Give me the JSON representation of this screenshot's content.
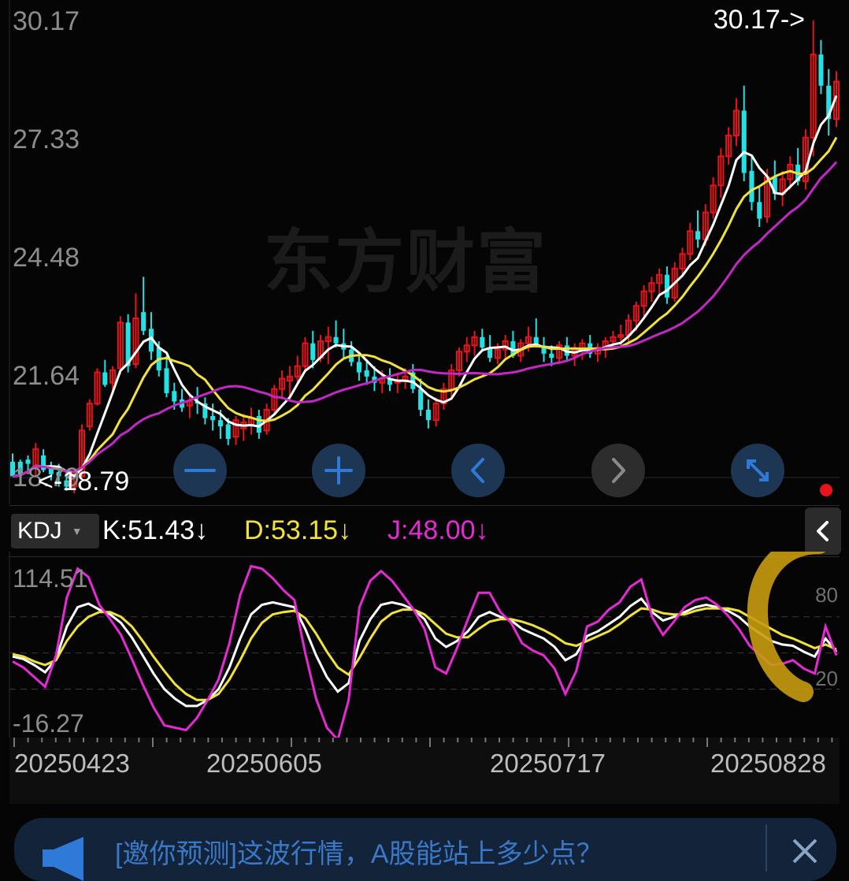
{
  "price_axis": {
    "labels": [
      "30.17",
      "27.33",
      "24.48",
      "21.64",
      "18.79"
    ],
    "ymin": 18.79,
    "ymax": 30.17
  },
  "high_marker": "30.17->",
  "low_marker": "<-18.79",
  "watermark": "东方财富",
  "controls": [
    {
      "name": "zoom-out-button",
      "icon": "minus-icon"
    },
    {
      "name": "zoom-in-button",
      "icon": "plus-icon"
    },
    {
      "name": "scroll-left-button",
      "icon": "chevron-left-icon"
    },
    {
      "name": "scroll-right-button",
      "icon": "chevron-right-icon"
    },
    {
      "name": "expand-button",
      "icon": "expand-icon"
    }
  ],
  "indicator": {
    "name": "KDJ",
    "k_text": "K:51.43↓",
    "d_text": "D:53.15↓",
    "j_text": "J:48.00↓",
    "k_color": "#ffffff",
    "d_color": "#f0e23a",
    "j_color": "#e629d4"
  },
  "kdj_axis": {
    "top": "114.51",
    "bottom": "-16.27",
    "ref_high": "80",
    "ref_low": "20",
    "ymin": -16.27,
    "ymax": 114.51
  },
  "dates": [
    "20250423",
    "20250605",
    "20250717",
    "20250828"
  ],
  "banner": {
    "text": "[邀你预测]这波行情，A股能站上多少点？"
  },
  "colors": {
    "up": "#e8141b",
    "down": "#22e2e6",
    "ma5": "#ffffff",
    "ma10": "#f0e23a",
    "ma20": "#c327c6",
    "accent": "#2f7ad8"
  },
  "chart_data": [
    {
      "type": "candlestick",
      "title": "",
      "ylim": [
        18.79,
        30.17
      ],
      "ohlc": [
        [
          19.55,
          19.75,
          19.35,
          19.2
        ],
        [
          19.55,
          19.6,
          19.3,
          19.25
        ],
        [
          19.6,
          19.7,
          19.25,
          19.5
        ],
        [
          19.4,
          20.0,
          19.2,
          19.85
        ],
        [
          19.7,
          19.85,
          19.3,
          19.35
        ],
        [
          19.45,
          19.55,
          19.1,
          19.25
        ],
        [
          19.3,
          19.5,
          18.95,
          19.2
        ],
        [
          19.1,
          19.3,
          18.85,
          18.95
        ],
        [
          18.95,
          19.35,
          18.79,
          19.25
        ],
        [
          19.2,
          20.45,
          19.1,
          20.3
        ],
        [
          20.4,
          21.05,
          20.3,
          20.95
        ],
        [
          20.95,
          21.8,
          20.9,
          21.7
        ],
        [
          21.7,
          22.0,
          21.35,
          21.4
        ],
        [
          21.45,
          21.85,
          21.2,
          21.75
        ],
        [
          21.8,
          23.05,
          21.65,
          22.9
        ],
        [
          22.9,
          23.1,
          21.7,
          21.85
        ],
        [
          21.9,
          23.6,
          21.8,
          23.0
        ],
        [
          23.15,
          24.0,
          22.6,
          22.7
        ],
        [
          22.75,
          23.15,
          22.0,
          22.2
        ],
        [
          22.3,
          22.45,
          21.6,
          21.75
        ],
        [
          21.8,
          22.1,
          21.1,
          21.2
        ],
        [
          21.25,
          21.45,
          20.8,
          21.0
        ],
        [
          21.05,
          21.3,
          20.75,
          20.85
        ],
        [
          20.9,
          21.2,
          20.6,
          21.0
        ],
        [
          21.0,
          21.35,
          20.7,
          20.95
        ],
        [
          20.95,
          21.1,
          20.45,
          20.6
        ],
        [
          20.65,
          20.95,
          20.3,
          20.55
        ],
        [
          20.55,
          20.8,
          20.1,
          20.4
        ],
        [
          20.45,
          20.6,
          19.95,
          20.1
        ],
        [
          20.15,
          20.65,
          19.95,
          20.55
        ],
        [
          20.35,
          20.7,
          20.05,
          20.5
        ],
        [
          20.45,
          20.85,
          20.2,
          20.6
        ],
        [
          20.65,
          20.8,
          20.1,
          20.25
        ],
        [
          20.3,
          20.95,
          20.2,
          20.8
        ],
        [
          20.8,
          21.4,
          20.7,
          21.3
        ],
        [
          21.3,
          21.75,
          21.05,
          21.55
        ],
        [
          21.5,
          21.85,
          21.0,
          21.6
        ],
        [
          21.6,
          22.1,
          21.4,
          21.85
        ],
        [
          21.85,
          22.55,
          21.7,
          22.4
        ],
        [
          22.4,
          22.7,
          21.8,
          22.0
        ],
        [
          22.05,
          22.6,
          21.95,
          22.45
        ],
        [
          22.45,
          22.8,
          21.9,
          22.55
        ],
        [
          22.55,
          22.95,
          22.3,
          22.4
        ],
        [
          22.4,
          22.75,
          22.05,
          22.25
        ],
        [
          22.25,
          22.45,
          21.85,
          21.95
        ],
        [
          21.95,
          22.1,
          21.5,
          21.7
        ],
        [
          21.75,
          22.0,
          21.4,
          21.6
        ],
        [
          21.6,
          21.85,
          21.25,
          21.45
        ],
        [
          21.45,
          21.75,
          21.2,
          21.55
        ],
        [
          21.55,
          21.8,
          21.25,
          21.4
        ],
        [
          21.45,
          21.7,
          21.2,
          21.5
        ],
        [
          21.5,
          21.8,
          21.3,
          21.6
        ],
        [
          21.7,
          21.9,
          21.2,
          21.3
        ],
        [
          21.3,
          21.55,
          20.65,
          20.8
        ],
        [
          20.8,
          21.05,
          20.35,
          20.55
        ],
        [
          20.55,
          21.1,
          20.4,
          20.95
        ],
        [
          20.95,
          21.45,
          20.8,
          21.3
        ],
        [
          21.3,
          21.9,
          21.1,
          21.75
        ],
        [
          21.75,
          22.3,
          21.6,
          22.2
        ],
        [
          22.2,
          22.55,
          21.95,
          22.35
        ],
        [
          22.35,
          22.7,
          22.1,
          22.55
        ],
        [
          22.55,
          22.75,
          22.2,
          22.3
        ],
        [
          22.3,
          22.6,
          21.95,
          22.05
        ],
        [
          22.05,
          22.4,
          21.9,
          22.25
        ],
        [
          22.25,
          22.6,
          22.05,
          22.45
        ],
        [
          22.45,
          22.7,
          22.05,
          22.1
        ],
        [
          22.1,
          22.5,
          21.95,
          22.4
        ],
        [
          22.4,
          22.8,
          22.2,
          22.55
        ],
        [
          22.55,
          23.0,
          22.3,
          22.35
        ],
        [
          22.35,
          22.55,
          21.95,
          22.15
        ],
        [
          22.15,
          22.35,
          21.85,
          22.05
        ],
        [
          22.05,
          22.45,
          21.9,
          22.35
        ],
        [
          22.35,
          22.55,
          21.95,
          22.1
        ],
        [
          22.1,
          22.4,
          21.85,
          22.25
        ],
        [
          22.25,
          22.5,
          22.0,
          22.4
        ],
        [
          22.4,
          22.6,
          22.05,
          22.15
        ],
        [
          22.15,
          22.4,
          21.95,
          22.3
        ],
        [
          22.3,
          22.55,
          22.05,
          22.45
        ],
        [
          22.45,
          22.7,
          22.25,
          22.55
        ],
        [
          22.55,
          22.85,
          22.3,
          22.6
        ],
        [
          22.6,
          23.1,
          22.4,
          22.95
        ],
        [
          22.95,
          23.4,
          22.7,
          23.3
        ],
        [
          23.3,
          23.8,
          23.05,
          23.65
        ],
        [
          23.65,
          24.0,
          23.4,
          23.85
        ],
        [
          23.85,
          24.2,
          23.55,
          24.05
        ],
        [
          24.05,
          24.25,
          23.35,
          23.5
        ],
        [
          23.5,
          24.35,
          23.4,
          24.2
        ],
        [
          24.2,
          24.7,
          24.0,
          24.55
        ],
        [
          24.55,
          25.3,
          24.4,
          25.1
        ],
        [
          25.1,
          25.6,
          24.7,
          24.9
        ],
        [
          24.9,
          25.75,
          24.75,
          25.55
        ],
        [
          25.55,
          26.4,
          25.4,
          26.2
        ],
        [
          26.2,
          27.1,
          25.9,
          26.9
        ],
        [
          26.9,
          27.6,
          26.7,
          27.4
        ],
        [
          27.4,
          28.3,
          27.15,
          28.0
        ],
        [
          28.0,
          28.6,
          26.3,
          26.5
        ],
        [
          26.55,
          26.9,
          25.6,
          25.8
        ],
        [
          25.8,
          26.15,
          25.2,
          25.4
        ],
        [
          25.45,
          26.6,
          25.3,
          26.4
        ],
        [
          26.4,
          26.8,
          25.85,
          26.0
        ],
        [
          26.0,
          26.55,
          25.7,
          26.35
        ],
        [
          26.35,
          26.9,
          26.1,
          26.7
        ],
        [
          26.7,
          27.1,
          26.2,
          26.3
        ],
        [
          26.3,
          27.55,
          26.1,
          27.35
        ],
        [
          27.35,
          30.17,
          26.9,
          29.35
        ],
        [
          29.35,
          29.7,
          28.4,
          28.6
        ],
        [
          28.6,
          29.0,
          27.4,
          27.8
        ],
        [
          27.8,
          28.95,
          27.6,
          28.7
        ]
      ]
    },
    {
      "type": "line",
      "title": "KDJ",
      "ylim": [
        -16.27,
        114.51
      ],
      "series": [
        {
          "name": "K",
          "values": [
            47,
            45,
            40,
            34,
            45,
            72,
            88,
            91,
            86,
            82,
            75,
            63,
            48,
            33,
            20,
            12,
            6,
            6,
            11,
            20,
            38,
            62,
            82,
            90,
            92,
            90,
            88,
            70,
            48,
            30,
            18,
            25,
            60,
            78,
            90,
            92,
            90,
            86,
            78,
            62,
            55,
            60,
            68,
            80,
            84,
            80,
            77,
            70,
            66,
            62,
            55,
            44,
            49,
            64,
            68,
            74,
            80,
            89,
            95,
            84,
            77,
            80,
            84,
            88,
            90,
            88,
            85,
            80,
            72,
            66,
            60,
            57,
            56,
            51,
            47,
            62,
            51
          ]
        },
        {
          "name": "D",
          "values": [
            49,
            47,
            43,
            40,
            44,
            60,
            72,
            80,
            84,
            84,
            80,
            72,
            60,
            47,
            35,
            24,
            16,
            11,
            11,
            16,
            28,
            44,
            62,
            75,
            82,
            84,
            85,
            79,
            66,
            51,
            38,
            32,
            46,
            62,
            76,
            83,
            86,
            86,
            82,
            74,
            66,
            63,
            63,
            70,
            76,
            78,
            78,
            76,
            73,
            69,
            64,
            58,
            56,
            60,
            64,
            68,
            74,
            81,
            87,
            86,
            83,
            82,
            82,
            85,
            87,
            87,
            87,
            85,
            80,
            75,
            70,
            65,
            62,
            58,
            54,
            57,
            53
          ]
        },
        {
          "name": "J",
          "values": [
            43,
            38,
            30,
            22,
            48,
            96,
            120,
            113,
            90,
            78,
            65,
            45,
            24,
            5,
            -10,
            -12,
            -14,
            -4,
            11,
            28,
            58,
            98,
            122,
            120,
            112,
            102,
            94,
            50,
            12,
            -12,
            -22,
            11,
            88,
            110,
            118,
            110,
            98,
            86,
            70,
            38,
            33,
            54,
            78,
            100,
            100,
            84,
            75,
            58,
            52,
            48,
            37,
            16,
            35,
            72,
            76,
            86,
            92,
            105,
            111,
            80,
            65,
            76,
            88,
            94,
            96,
            90,
            81,
            70,
            56,
            48,
            40,
            41,
            44,
            37,
            33,
            72,
            48
          ]
        }
      ]
    }
  ]
}
